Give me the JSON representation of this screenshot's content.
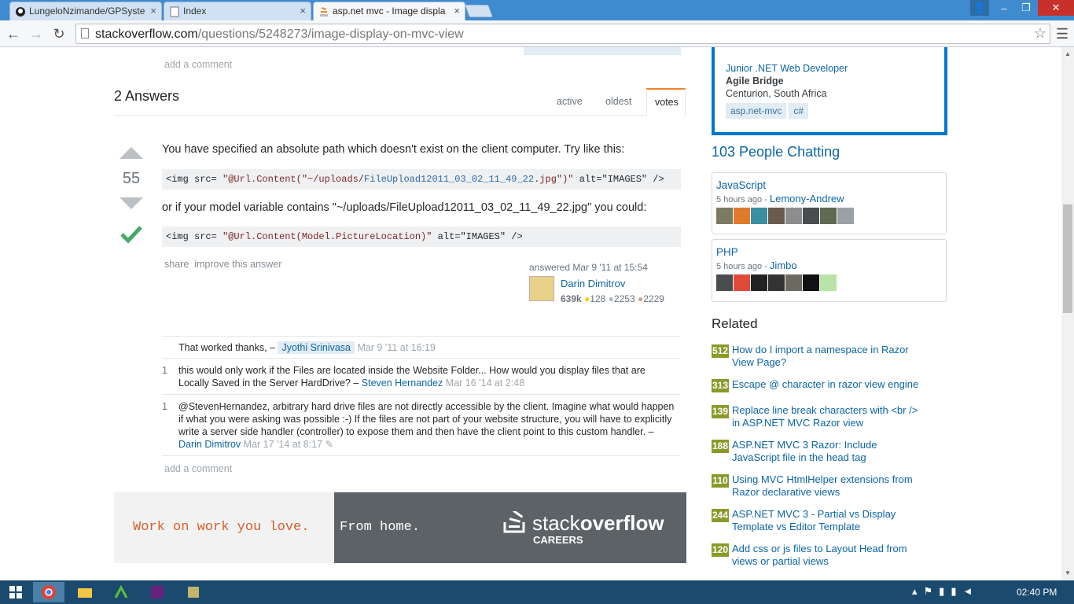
{
  "browser": {
    "tabs": [
      {
        "label": "LungeloNzimande/GPSyste",
        "icon": "github-icon"
      },
      {
        "label": "Index",
        "icon": "page-icon"
      },
      {
        "label": "asp.net mvc - Image displa",
        "icon": "stackoverflow-icon"
      }
    ],
    "url_host": "stackoverflow.com",
    "url_path": "/questions/5248273/image-display-on-mvc-view"
  },
  "question": {
    "add_comment": "add a comment"
  },
  "answers_header": {
    "title": "2 Answers",
    "sort_tabs": [
      "active",
      "oldest",
      "votes"
    ],
    "active_tab": "votes"
  },
  "answer": {
    "votes": "55",
    "text1": "You have specified an absolute path which doesn't exist on the client computer. Try like this:",
    "code1_a": "<img src= ",
    "code1_b": "\"@Url.Content(\"~/uploads/",
    "code1_c": "FileUpload12011_03_02_11_49_22",
    "code1_d": ".jpg\")\"",
    "code1_e": " alt=\"IMAGES\" />",
    "text2": "or if your model variable contains \"~/uploads/FileUpload12011_03_02_11_49_22.jpg\" you could:",
    "code2_a": "<img src= ",
    "code2_b": "\"@Url.Content(Model.PictureLocation)\"",
    "code2_c": " alt=\"IMAGES\" />",
    "share": "share",
    "improve": "improve this answer",
    "answered": "answered Mar 9 '11 at 15:54",
    "user_name": "Darin Dimitrov",
    "user_rep": "639k",
    "gold": "128",
    "silver": "2253",
    "bronze": "2229"
  },
  "comments": [
    {
      "score": "",
      "text": "That worked thanks, – ",
      "user": "Jyothi Srinivasa",
      "date": "Mar 9 '11 at 16:19"
    },
    {
      "score": "1",
      "text": "this would only work if the Files are located inside the Website Folder... How would you display files that are Locally Saved in the Server HardDrive? – ",
      "user": "Steven Hernandez",
      "date": "Mar 16 '14 at 2:48"
    },
    {
      "score": "1",
      "text": "@StevenHernandez, arbitrary hard drive files are not directly accessible by the client. Imagine what would happen if what you were asking was possible :-) If the files are not part of your website structure, you will have to explicitly write a server side handler (controller) to expose them and then have the client point to this custom handler. – ",
      "user": "Darin Dimitrov",
      "date": "Mar 17 '14 at 8:17"
    }
  ],
  "answer_add_comment": "add a comment",
  "ad": {
    "tagline1": "Work on work you love.",
    "tagline2": "From home.",
    "brand_a": "stack",
    "brand_b": "overflow",
    "brand_sub": "CAREERS"
  },
  "job": {
    "title": "Junior .NET Web Developer",
    "company": "Agile Bridge",
    "location": "Centurion, South Africa",
    "tags": [
      "asp.net-mvc",
      "c#"
    ]
  },
  "chat": {
    "title": "103 People Chatting",
    "rooms": [
      {
        "name": "JavaScript",
        "time": "5 hours ago",
        "user": "Lemony-Andrew"
      },
      {
        "name": "PHP",
        "time": "5 hours ago",
        "user": "Jimbo"
      }
    ]
  },
  "related": {
    "title": "Related",
    "items": [
      {
        "score": "512",
        "title": "How do I import a namespace in Razor View Page?"
      },
      {
        "score": "313",
        "title": "Escape @ character in razor view engine"
      },
      {
        "score": "139",
        "title": "Replace line break characters with <br /> in ASP.NET MVC Razor view"
      },
      {
        "score": "188",
        "title": "ASP.NET MVC 3 Razor: Include JavaScript file in the head tag"
      },
      {
        "score": "110",
        "title": "Using MVC HtmlHelper extensions from Razor declarative views"
      },
      {
        "score": "244",
        "title": "ASP.NET MVC 3 - Partial vs Display Template vs Editor Template"
      },
      {
        "score": "120",
        "title": "Add css or js files to Layout Head from views or partial views"
      }
    ]
  },
  "taskbar": {
    "clock": "02:40 PM"
  }
}
